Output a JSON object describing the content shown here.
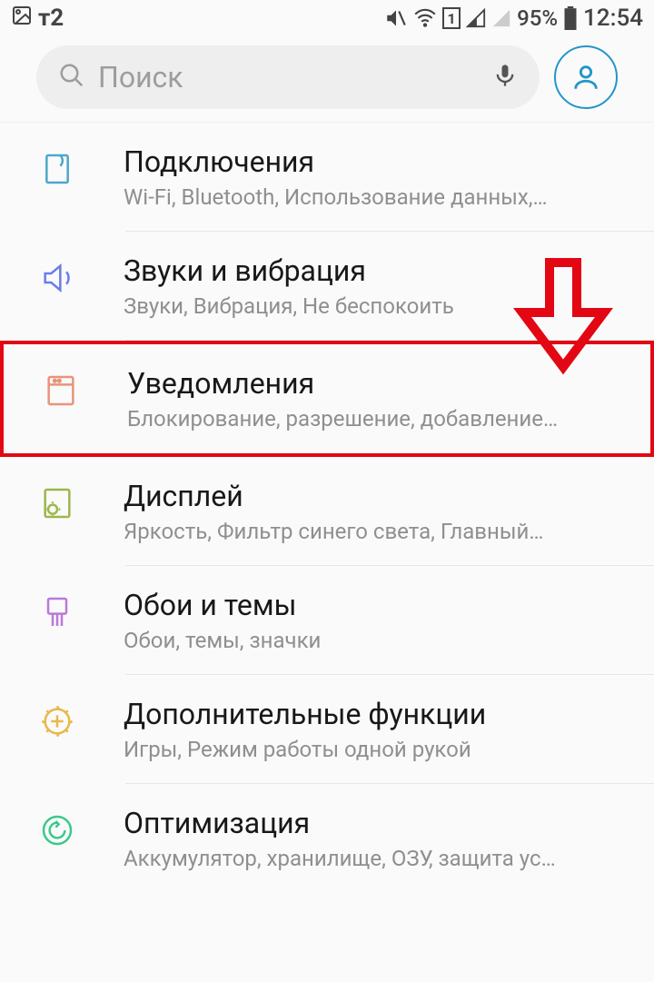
{
  "status": {
    "carrier": "т2",
    "battery_pct": "95%",
    "time": "12:54"
  },
  "search": {
    "placeholder": "Поиск"
  },
  "items": [
    {
      "title": "Подключения",
      "sub": "Wi-Fi, Bluetooth, Использование данных,…"
    },
    {
      "title": "Звуки и вибрация",
      "sub": "Звуки, Вибрация, Не беспокоить"
    },
    {
      "title": "Уведомления",
      "sub": "Блокирование, разрешение, добавление…"
    },
    {
      "title": "Дисплей",
      "sub": "Яркость, Фильтр синего света, Главный…"
    },
    {
      "title": "Обои и темы",
      "sub": "Обои, темы, значки"
    },
    {
      "title": "Дополнительные функции",
      "sub": "Игры, Режим работы одной рукой"
    },
    {
      "title": "Оптимизация",
      "sub": "Аккумулятор, хранилище, ОЗУ, защита ус…"
    }
  ]
}
